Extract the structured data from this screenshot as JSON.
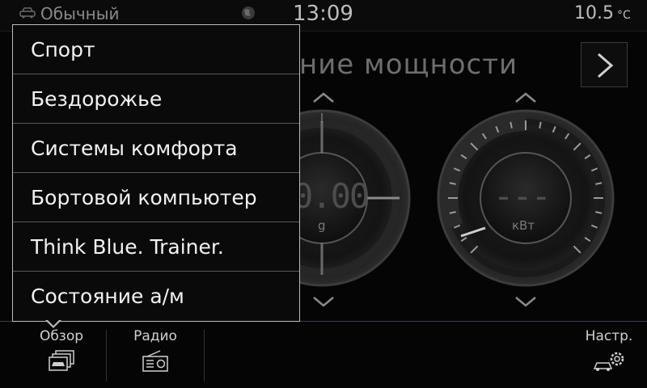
{
  "status": {
    "profile_label": "Обычный",
    "time": "13:09",
    "temperature": "10.5",
    "temperature_unit": "°C"
  },
  "main": {
    "title": "ние мощности",
    "gauge_left": {
      "value": "0.00",
      "unit": "g"
    },
    "gauge_right": {
      "value": "---",
      "unit": "кВт"
    }
  },
  "menu": {
    "items": [
      {
        "label": "Спорт"
      },
      {
        "label": "Бездорожье"
      },
      {
        "label": "Системы комфорта"
      },
      {
        "label": "Бортовой компьютер"
      },
      {
        "label": "Think Blue. Trainer."
      },
      {
        "label": "Состояние а/м"
      }
    ]
  },
  "nav": {
    "overview_label": "Обзор",
    "radio_label": "Радио",
    "settings_label": "Настр."
  },
  "colors": {
    "background": "#050505",
    "divider_accent": "#2a3a8a",
    "menu_border": "#bcbcbc"
  },
  "icons": {
    "profile": "car-profile-icon",
    "globe": "globe-icon",
    "next": "chevron-right-icon",
    "overview": "car-stack-icon",
    "radio": "radio-icon",
    "settings": "car-gear-icon"
  }
}
